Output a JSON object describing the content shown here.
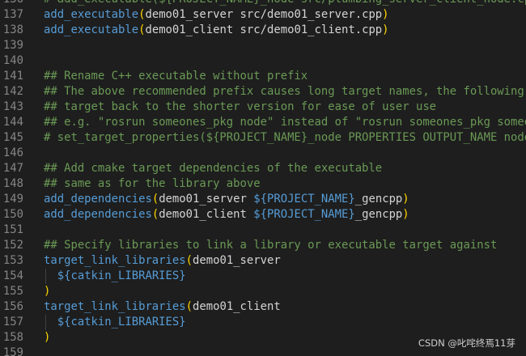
{
  "editor": {
    "lines": [
      {
        "number": "136",
        "tokens": [
          {
            "text": "# add_executable(${PROJECT_NAME}_node src/plumbing_server_client_node.cpp)",
            "type": "comment"
          }
        ]
      },
      {
        "number": "137",
        "tokens": [
          {
            "text": "add_executable",
            "type": "func"
          },
          {
            "text": "(",
            "type": "paren"
          },
          {
            "text": "demo01_server src/demo01_server.cpp",
            "type": "plain"
          },
          {
            "text": ")",
            "type": "paren"
          }
        ]
      },
      {
        "number": "138",
        "tokens": [
          {
            "text": "add_executable",
            "type": "func"
          },
          {
            "text": "(",
            "type": "paren"
          },
          {
            "text": "demo01_client src/demo01_client.cpp",
            "type": "plain"
          },
          {
            "text": ")",
            "type": "paren"
          }
        ]
      },
      {
        "number": "139",
        "tokens": []
      },
      {
        "number": "140",
        "tokens": []
      },
      {
        "number": "141",
        "tokens": [
          {
            "text": "## Rename C++ executable without prefix",
            "type": "comment"
          }
        ]
      },
      {
        "number": "142",
        "tokens": [
          {
            "text": "## The above recommended prefix causes long target names, the following renames the",
            "type": "comment"
          }
        ]
      },
      {
        "number": "143",
        "tokens": [
          {
            "text": "## target back to the shorter version for ease of user use",
            "type": "comment"
          }
        ]
      },
      {
        "number": "144",
        "tokens": [
          {
            "text": "## e.g. \"rosrun someones_pkg node\" instead of \"rosrun someones_pkg someones_pkg_node\"",
            "type": "comment"
          }
        ]
      },
      {
        "number": "145",
        "tokens": [
          {
            "text": "# set_target_properties(${PROJECT_NAME}_node PROPERTIES OUTPUT_NAME node PREFIX \"\")",
            "type": "comment"
          }
        ]
      },
      {
        "number": "146",
        "tokens": []
      },
      {
        "number": "147",
        "tokens": [
          {
            "text": "## Add cmake target dependencies of the executable",
            "type": "comment"
          }
        ]
      },
      {
        "number": "148",
        "tokens": [
          {
            "text": "## same as for the library above",
            "type": "comment"
          }
        ]
      },
      {
        "number": "149",
        "tokens": [
          {
            "text": "add_dependencies",
            "type": "func"
          },
          {
            "text": "(",
            "type": "paren"
          },
          {
            "text": "demo01_server ",
            "type": "plain"
          },
          {
            "text": "${",
            "type": "var"
          },
          {
            "text": "PROJECT_NAME",
            "type": "func"
          },
          {
            "text": "}",
            "type": "var"
          },
          {
            "text": "_gencpp",
            "type": "plain"
          },
          {
            "text": ")",
            "type": "paren"
          }
        ]
      },
      {
        "number": "150",
        "tokens": [
          {
            "text": "add_dependencies",
            "type": "func"
          },
          {
            "text": "(",
            "type": "paren"
          },
          {
            "text": "demo01_client ",
            "type": "plain"
          },
          {
            "text": "${",
            "type": "var"
          },
          {
            "text": "PROJECT_NAME",
            "type": "func"
          },
          {
            "text": "}",
            "type": "var"
          },
          {
            "text": "_gencpp",
            "type": "plain"
          },
          {
            "text": ")",
            "type": "paren"
          }
        ]
      },
      {
        "number": "151",
        "tokens": []
      },
      {
        "number": "152",
        "tokens": [
          {
            "text": "## Specify libraries to link a library or executable target against",
            "type": "comment"
          }
        ]
      },
      {
        "number": "153",
        "tokens": [
          {
            "text": "target_link_libraries",
            "type": "func"
          },
          {
            "text": "(",
            "type": "paren"
          },
          {
            "text": "demo01_server",
            "type": "plain"
          }
        ]
      },
      {
        "number": "154",
        "indent": true,
        "tokens": [
          {
            "text": "  ",
            "type": "plain"
          },
          {
            "text": "${",
            "type": "var"
          },
          {
            "text": "catkin_LIBRARIES",
            "type": "func"
          },
          {
            "text": "}",
            "type": "var"
          }
        ]
      },
      {
        "number": "155",
        "tokens": [
          {
            "text": ")",
            "type": "paren"
          }
        ]
      },
      {
        "number": "156",
        "tokens": [
          {
            "text": "target_link_libraries",
            "type": "func"
          },
          {
            "text": "(",
            "type": "paren"
          },
          {
            "text": "demo01_client",
            "type": "plain"
          }
        ]
      },
      {
        "number": "157",
        "indent": true,
        "tokens": [
          {
            "text": "  ",
            "type": "plain"
          },
          {
            "text": "${",
            "type": "var"
          },
          {
            "text": "catkin_LIBRARIES",
            "type": "func"
          },
          {
            "text": "}",
            "type": "var"
          }
        ]
      },
      {
        "number": "158",
        "tokens": [
          {
            "text": ")",
            "type": "paren"
          }
        ]
      },
      {
        "number": "159",
        "tokens": []
      }
    ]
  },
  "watermark": {
    "text": "CSDN @叱咤终焉11芽"
  },
  "colors": {
    "background": "#1e1e1e",
    "line_number": "#858585",
    "comment": "#6a9955",
    "keyword_blue": "#569cd6",
    "paren_gold": "#ffd700",
    "plain_text": "#d4d4d4"
  }
}
